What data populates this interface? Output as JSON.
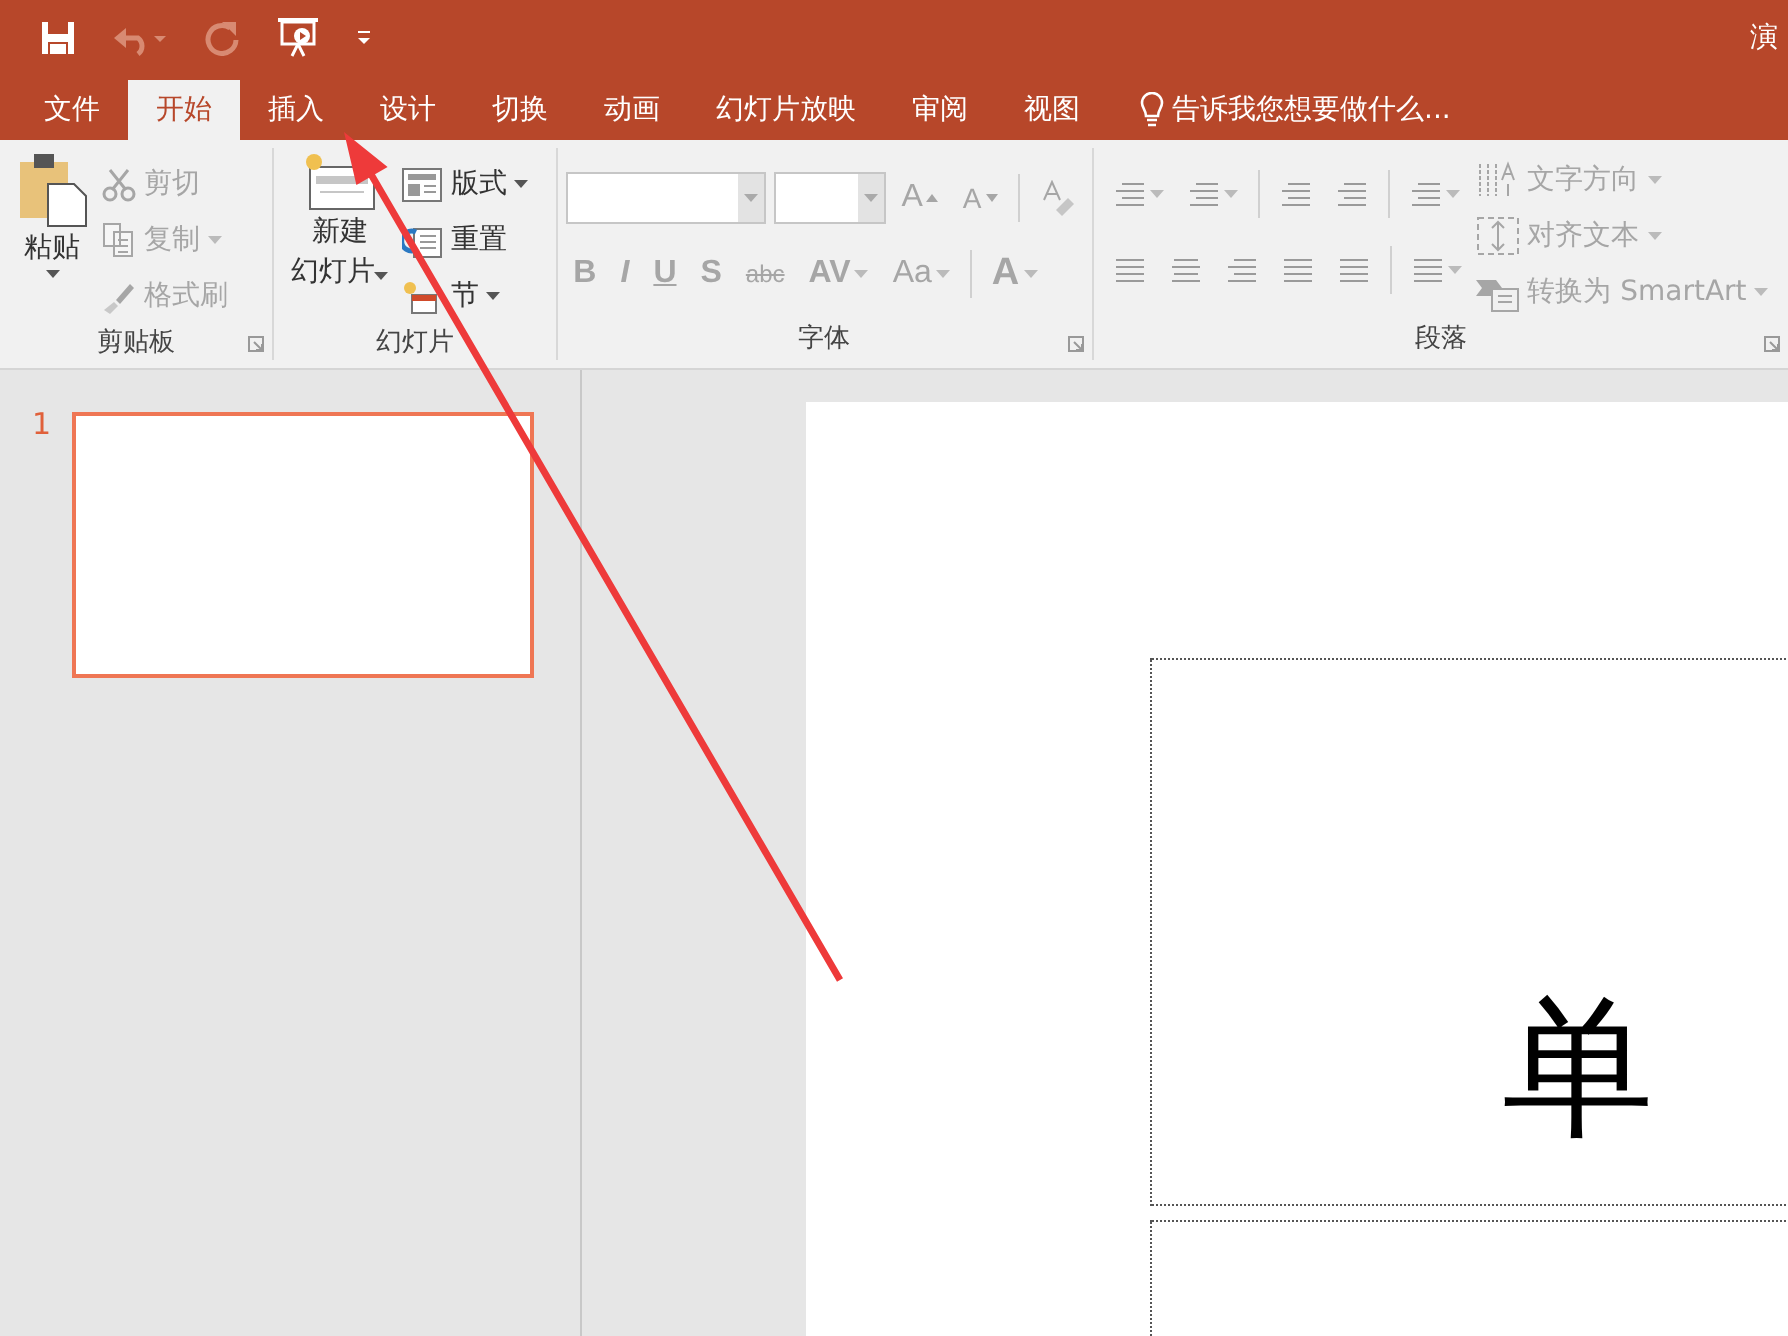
{
  "window": {
    "title": "演"
  },
  "tabs": [
    {
      "label": "文件",
      "selected": false
    },
    {
      "label": "开始",
      "selected": true
    },
    {
      "label": "插入",
      "selected": false
    },
    {
      "label": "设计",
      "selected": false
    },
    {
      "label": "切换",
      "selected": false
    },
    {
      "label": "动画",
      "selected": false
    },
    {
      "label": "幻灯片放映",
      "selected": false
    },
    {
      "label": "审阅",
      "selected": false
    },
    {
      "label": "视图",
      "selected": false
    }
  ],
  "tell_me": "告诉我您想要做什么...",
  "clipboard": {
    "label": "剪贴板",
    "paste": "粘贴",
    "items": [
      {
        "label": "剪切",
        "disabled": true,
        "dropdown": false
      },
      {
        "label": "复制",
        "disabled": true,
        "dropdown": true
      },
      {
        "label": "格式刷",
        "disabled": true,
        "dropdown": false
      }
    ]
  },
  "slides_group": {
    "label": "幻灯片",
    "new_slide_1": "新建",
    "new_slide_2": "幻灯片",
    "items": [
      {
        "label": "版式",
        "disabled": false,
        "dropdown": true
      },
      {
        "label": "重置",
        "disabled": false,
        "dropdown": false
      },
      {
        "label": "节",
        "disabled": false,
        "dropdown": true
      }
    ]
  },
  "font": {
    "label": "字体",
    "grow": "A",
    "shrink": "A",
    "buttons": [
      {
        "text": "B",
        "dropdown": false
      },
      {
        "text": "I",
        "dropdown": false
      },
      {
        "text": "U",
        "dropdown": false
      },
      {
        "text": "S",
        "dropdown": false
      },
      {
        "text": "abc",
        "dropdown": false
      },
      {
        "text": "AV",
        "dropdown": true
      },
      {
        "text": "Aa",
        "dropdown": true
      },
      {
        "text": "A",
        "dropdown": true
      }
    ]
  },
  "paragraph": {
    "label": "段落",
    "items": [
      {
        "label": "文字方向",
        "dropdown": true
      },
      {
        "label": "对齐文本",
        "dropdown": true
      },
      {
        "label": "转换为 SmartArt",
        "dropdown": true
      }
    ]
  },
  "slide_pane": {
    "slides": [
      {
        "number": "1",
        "selected": true
      }
    ]
  },
  "slide": {
    "title": "单"
  }
}
